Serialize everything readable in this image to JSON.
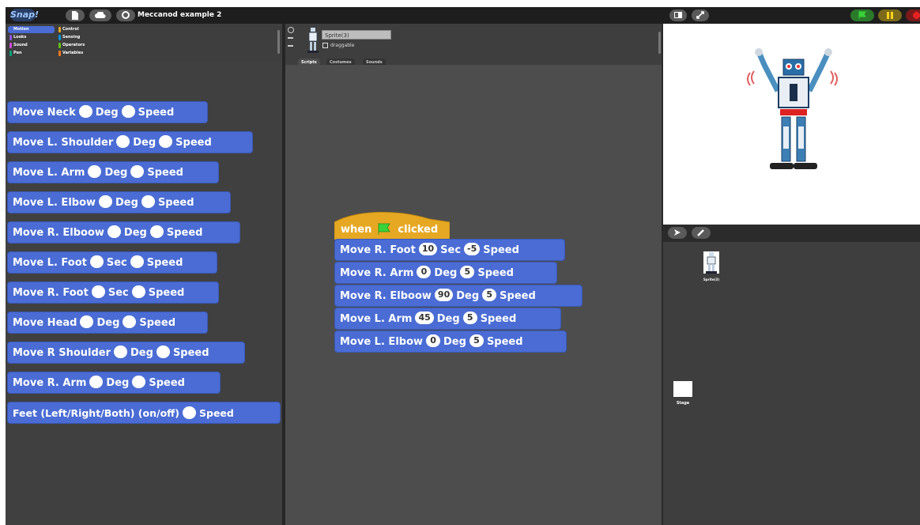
{
  "app": {
    "logo": "Snap!",
    "project_title": "Meccanod example 2",
    "accent_color": "#4a6cd4",
    "hat_color": "#e6a823"
  },
  "topbar": {
    "file_icon": "file-icon",
    "cloud_icon": "cloud-icon",
    "settings_icon": "gear-icon",
    "stage_layout_icon": "stage-layout-icon",
    "fullscreen_icon": "fullscreen-icon",
    "green_flag_icon": "green-flag-icon",
    "pause_icon": "pause-icon",
    "stop_icon": "stop-icon"
  },
  "categories": [
    {
      "label": "Motion",
      "color": "#4a6cd4"
    },
    {
      "label": "Looks",
      "color": "#8f56e3"
    },
    {
      "label": "Sound",
      "color": "#cf4ad9"
    },
    {
      "label": "Pen",
      "color": "#00a178"
    },
    {
      "label": "Control",
      "color": "#e6a823"
    },
    {
      "label": "Sensing",
      "color": "#0494dc"
    },
    {
      "label": "Operators",
      "color": "#62c213"
    },
    {
      "label": "Variables",
      "color": "#f3761d"
    }
  ],
  "palette_blocks": [
    {
      "parts": [
        "Move Neck",
        "Deg",
        "Speed"
      ]
    },
    {
      "parts": [
        "Move L. Shoulder",
        "Deg",
        "Speed"
      ]
    },
    {
      "parts": [
        "Move L. Arm",
        "Deg",
        "Speed"
      ]
    },
    {
      "parts": [
        "Move L. Elbow",
        "Deg",
        "Speed"
      ]
    },
    {
      "parts": [
        "Move R. Elboow",
        "Deg",
        "Speed"
      ]
    },
    {
      "parts": [
        "Move L. Foot",
        "Sec",
        "Speed"
      ]
    },
    {
      "parts": [
        "Move R. Foot",
        "Sec",
        "Speed"
      ]
    },
    {
      "parts": [
        "Move Head",
        "Deg",
        "Speed"
      ]
    },
    {
      "parts": [
        "Move R Shoulder",
        "Deg",
        "Speed"
      ]
    },
    {
      "parts": [
        "Move R. Arm",
        "Deg",
        "Speed"
      ]
    },
    {
      "parts": [
        "Feet (Left/Right/Both) (on/off)",
        "Speed"
      ]
    }
  ],
  "sprite": {
    "name": "Sprite(3)",
    "draggable_label": "draggable",
    "tabs": [
      "Scripts",
      "Costumes",
      "Sounds"
    ]
  },
  "script": {
    "hat": {
      "before": "when",
      "after": "clicked"
    },
    "blocks": [
      {
        "a": "Move R. Foot",
        "v1": "10",
        "b": "Sec",
        "v2": "-5",
        "c": "Speed"
      },
      {
        "a": "Move R. Arm",
        "v1": "0",
        "b": "Deg",
        "v2": "5",
        "c": "Speed"
      },
      {
        "a": "Move R. Elboow",
        "v1": "90",
        "b": "Deg",
        "v2": "5",
        "c": "Speed"
      },
      {
        "a": "Move L. Arm",
        "v1": "45",
        "b": "Deg",
        "v2": "5",
        "c": "Speed"
      },
      {
        "a": "Move L. Elbow",
        "v1": "0",
        "b": "Deg",
        "v2": "5",
        "c": "Speed"
      }
    ]
  },
  "corral": {
    "sprite_label": "Sprite(3)",
    "stage_label": "Stage"
  }
}
